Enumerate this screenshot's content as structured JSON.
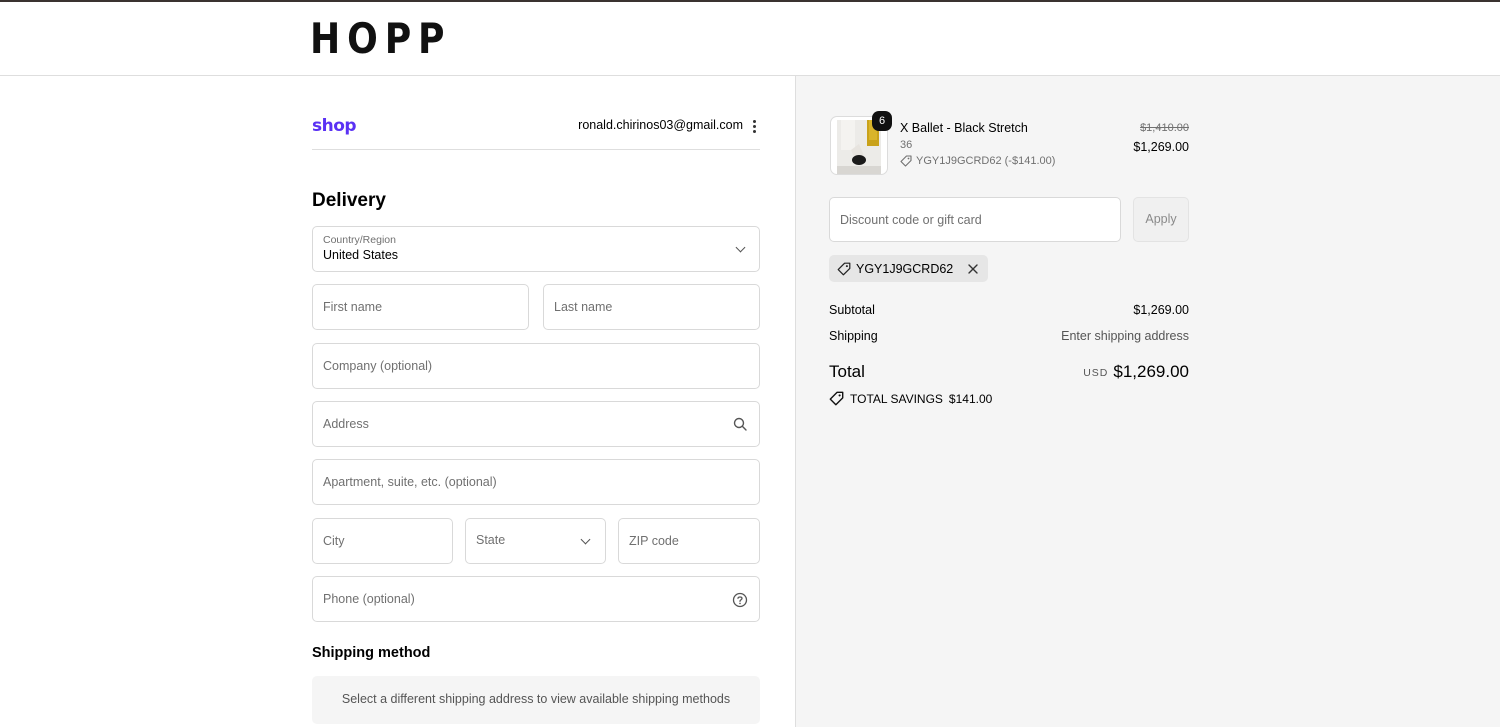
{
  "brand": {
    "logo_text": "HOPP"
  },
  "account": {
    "shop_logo": "shop",
    "email": "ronald.chirinos03@gmail.com"
  },
  "delivery": {
    "heading": "Delivery",
    "country": {
      "label": "Country/Region",
      "value": "United States"
    },
    "first_name": {
      "placeholder": "First name"
    },
    "last_name": {
      "placeholder": "Last name"
    },
    "company": {
      "placeholder": "Company (optional)"
    },
    "address": {
      "placeholder": "Address"
    },
    "apartment": {
      "placeholder": "Apartment, suite, etc. (optional)"
    },
    "city": {
      "placeholder": "City"
    },
    "state": {
      "placeholder": "State"
    },
    "zip": {
      "placeholder": "ZIP code"
    },
    "phone": {
      "placeholder": "Phone (optional)"
    }
  },
  "shipping_method": {
    "heading": "Shipping method",
    "notice": "Select a different shipping address to view available shipping methods"
  },
  "summary": {
    "item": {
      "quantity": "6",
      "name": "X Ballet - Black Stretch",
      "variant": "36",
      "discount": "YGY1J9GCRD62 (-$141.00)",
      "original_price": "$1,410.00",
      "price": "$1,269.00"
    },
    "discount_input": {
      "placeholder": "Discount code or gift card"
    },
    "apply_label": "Apply",
    "applied_code": "YGY1J9GCRD62",
    "subtotal_label": "Subtotal",
    "subtotal_value": "$1,269.00",
    "shipping_label": "Shipping",
    "shipping_value": "Enter shipping address",
    "total_label": "Total",
    "currency": "USD",
    "total_value": "$1,269.00",
    "savings_label": "TOTAL SAVINGS",
    "savings_value": "$141.00"
  },
  "colors": {
    "shop_brand": "#5a31f4",
    "panel_bg": "#f5f5f5",
    "text": "#000000",
    "muted": "#707070"
  },
  "icons": [
    "kebab-menu-icon",
    "chevron-down-icon",
    "search-icon",
    "help-circle-icon",
    "tag-icon",
    "close-icon"
  ]
}
